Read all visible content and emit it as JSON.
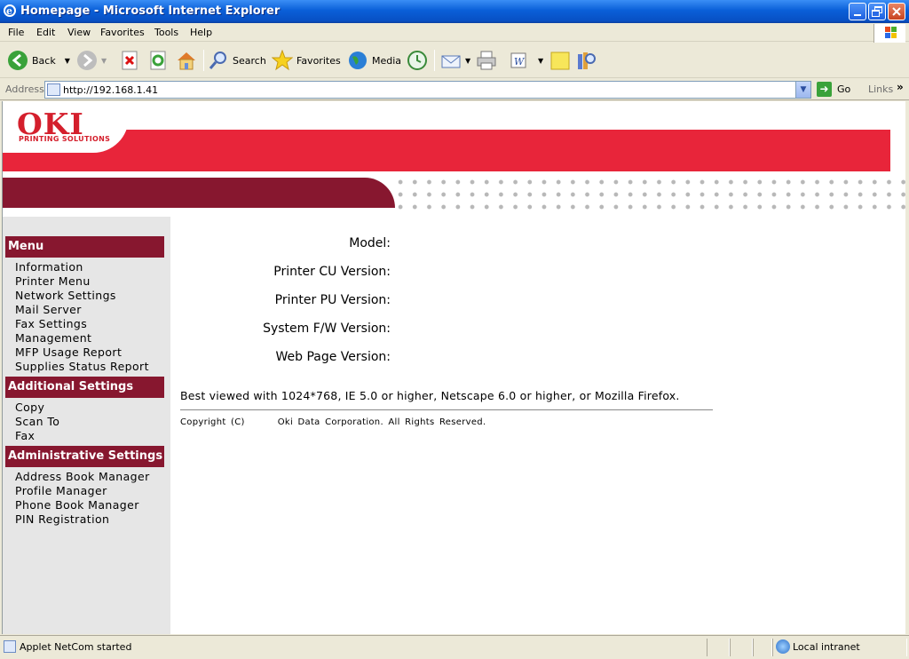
{
  "window": {
    "title": "Homepage - Microsoft Internet Explorer"
  },
  "menubar": [
    "File",
    "Edit",
    "View",
    "Favorites",
    "Tools",
    "Help"
  ],
  "toolbar": {
    "back": "Back",
    "search": "Search",
    "favorites": "Favorites",
    "media": "Media"
  },
  "address": {
    "label": "Address",
    "url": "http://192.168.1.41",
    "go": "Go",
    "links": "Links"
  },
  "page": {
    "logo": "OKI",
    "logo_sub": "PRINTING SOLUTIONS",
    "sections": [
      {
        "title": "Menu",
        "items": [
          "Information",
          "Printer Menu",
          "Network Settings",
          "Mail Server",
          "Fax Settings",
          "Management",
          "MFP Usage Report",
          "Supplies Status Report"
        ]
      },
      {
        "title": "Additional Settings",
        "items": [
          "Copy",
          "Scan To",
          "Fax"
        ]
      },
      {
        "title": "Administrative Settings",
        "items": [
          "Address Book Manager",
          "Profile Manager",
          "Phone Book Manager",
          "PIN Registration"
        ]
      }
    ],
    "fields": [
      "Model:",
      "Printer CU Version:",
      "Printer PU Version:",
      "System F/W Version:",
      "Web Page Version:"
    ],
    "best_viewed": "Best viewed with 1024*768, IE 5.0 or higher, Netscape 6.0 or higher, or Mozilla Firefox.",
    "copyright_left": "Copyright (C)",
    "copyright_right": "Oki Data Corporation. All Rights Reserved."
  },
  "status": {
    "text": "Applet NetCom started",
    "zone": "Local intranet"
  }
}
